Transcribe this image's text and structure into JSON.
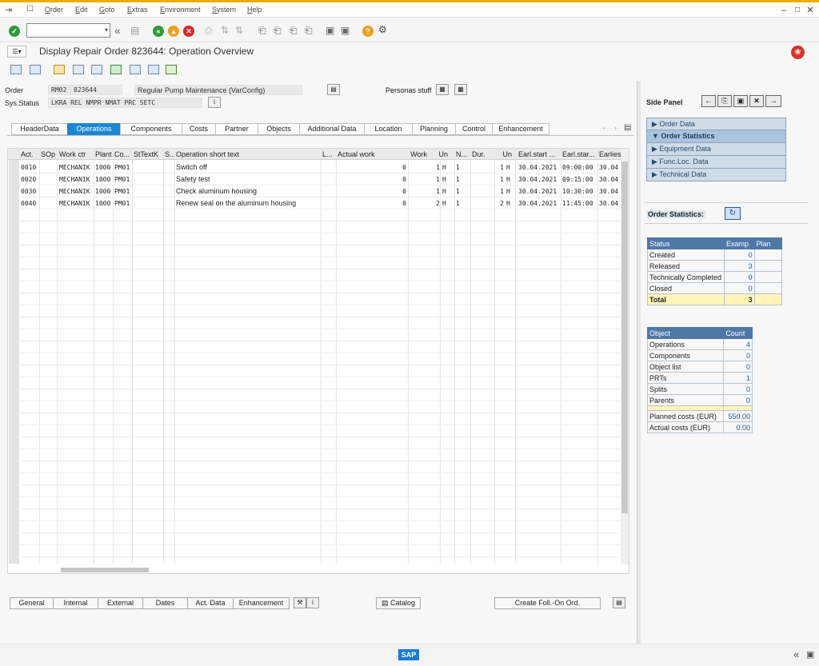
{
  "menu": [
    "Order",
    "Edit",
    "Goto",
    "Extras",
    "Environment",
    "System",
    "Help"
  ],
  "title": "Display Repair Order 823644: Operation Overview",
  "header": {
    "order_label": "Order",
    "order_type": "RM02",
    "order_no": "823644",
    "order_desc": "Regular Pump Maintenance (VarConfig)",
    "status_label": "Sys.Status",
    "status_value": "LKRA REL  NMPR NMAT PRC  SETC",
    "personas_label": "Personas stuff"
  },
  "tabs": [
    "HeaderData",
    "Operations",
    "Components",
    "Costs",
    "Partner",
    "Objects",
    "Additional Data",
    "Location",
    "Planning",
    "Control",
    "Enhancement"
  ],
  "active_tab": "Operations",
  "grid": {
    "columns": [
      "Act.",
      "SOp",
      "Work ctr",
      "Plant",
      "Co...",
      "StTextK",
      "S...",
      "Operation short text",
      "L...",
      "Actual work",
      "Work",
      "Un",
      "N...",
      "Dur.",
      "Un",
      "Earl.start ...",
      "Earl.star...",
      "Earliest"
    ],
    "rows": [
      {
        "act": "0010",
        "sop": "",
        "wc": "MECHANIK",
        "plant": "1000",
        "co": "PM01",
        "sttext": "",
        "s": "",
        "text": "Switch off",
        "l": "",
        "actual": "0",
        "work": "1",
        "un": "H",
        "n": "1",
        "dur": "1",
        "un2": "H",
        "es1": "30.04.2021",
        "es2": "09:00:00",
        "es3": "30.04"
      },
      {
        "act": "0020",
        "sop": "",
        "wc": "MECHANIK",
        "plant": "1000",
        "co": "PM01",
        "sttext": "",
        "s": "",
        "text": "Safety test",
        "l": "",
        "actual": "0",
        "work": "1",
        "un": "H",
        "n": "1",
        "dur": "1",
        "un2": "H",
        "es1": "30.04.2021",
        "es2": "09:15:00",
        "es3": "30.04"
      },
      {
        "act": "0030",
        "sop": "",
        "wc": "MECHANIK",
        "plant": "1000",
        "co": "PM01",
        "sttext": "",
        "s": "",
        "text": "Check aluminum housing",
        "l": "",
        "actual": "0",
        "work": "1",
        "un": "H",
        "n": "1",
        "dur": "1",
        "un2": "H",
        "es1": "30.04.2021",
        "es2": "10:30:00",
        "es3": "30.04"
      },
      {
        "act": "0040",
        "sop": "",
        "wc": "MECHANIK",
        "plant": "1000",
        "co": "PM01",
        "sttext": "",
        "s": "",
        "text": "Renew seal on the aluminum housing",
        "l": "",
        "actual": "0",
        "work": "2",
        "un": "H",
        "n": "1",
        "dur": "2",
        "un2": "H",
        "es1": "30.04.2021",
        "es2": "11:45:00",
        "es3": "30.04"
      }
    ]
  },
  "bottom_buttons": [
    "General",
    "Internal",
    "External",
    "Dates",
    "Act. Data",
    "Enhancement"
  ],
  "catalog_label": "Catalog",
  "follow_on_label": "Create Foll.-On Ord.",
  "side_panel": {
    "title": "Side Panel",
    "nav": [
      "Order Data",
      "Order Statistics",
      "Equipment Data",
      "Func.Loc. Data",
      "Technical Data"
    ],
    "nav_active": "Order Statistics",
    "section_title": "Order Statistics:",
    "status_table": {
      "headers": [
        "Status",
        "Examp",
        "Plan"
      ],
      "rows": [
        {
          "label": "Created",
          "value": "0"
        },
        {
          "label": "Released",
          "value": "3"
        },
        {
          "label": "Technically Completed",
          "value": "0"
        },
        {
          "label": "Closed",
          "value": "0"
        }
      ],
      "total_label": "Total",
      "total_value": "3"
    },
    "object_table": {
      "headers": [
        "Object",
        "Count"
      ],
      "rows": [
        {
          "label": "Operations",
          "value": "4"
        },
        {
          "label": "Components",
          "value": "0"
        },
        {
          "label": "Object list",
          "value": "0"
        },
        {
          "label": "PRTs",
          "value": "1"
        },
        {
          "label": "Splits",
          "value": "0"
        },
        {
          "label": "Parents",
          "value": "0"
        }
      ],
      "planned_label": "Planned costs (EUR)",
      "planned_value": "550.00",
      "actual_label": "Actual costs (EUR)",
      "actual_value": "0.00"
    }
  },
  "footer_logo": "SAP"
}
